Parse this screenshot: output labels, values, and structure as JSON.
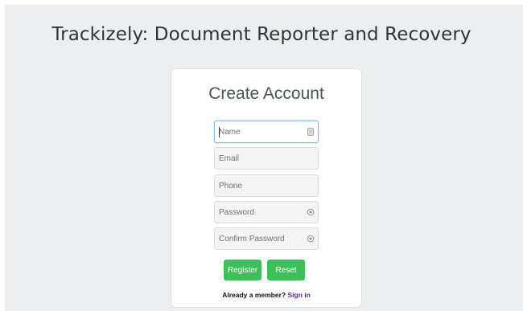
{
  "app": {
    "title": "Trackizely: Document Reporter and Recovery"
  },
  "form": {
    "heading": "Create Account",
    "fields": {
      "name": {
        "placeholder": "Name",
        "value": ""
      },
      "email": {
        "placeholder": "Email",
        "value": ""
      },
      "phone": {
        "placeholder": "Phone",
        "value": ""
      },
      "password": {
        "placeholder": "Password",
        "value": ""
      },
      "confirm_password": {
        "placeholder": "Confirm Password",
        "value": ""
      }
    },
    "icons": {
      "name": "id-card-icon",
      "password": "eye-icon",
      "confirm_password": "eye-icon"
    },
    "buttons": {
      "register": "Register",
      "reset": "Reset"
    },
    "member_prompt": "Already a member?",
    "sign_in_link": "Sign in"
  },
  "colors": {
    "background": "#eceeef",
    "button": "#3cc15a",
    "link": "#5b2c8e",
    "focus_border": "#88b8e8"
  }
}
